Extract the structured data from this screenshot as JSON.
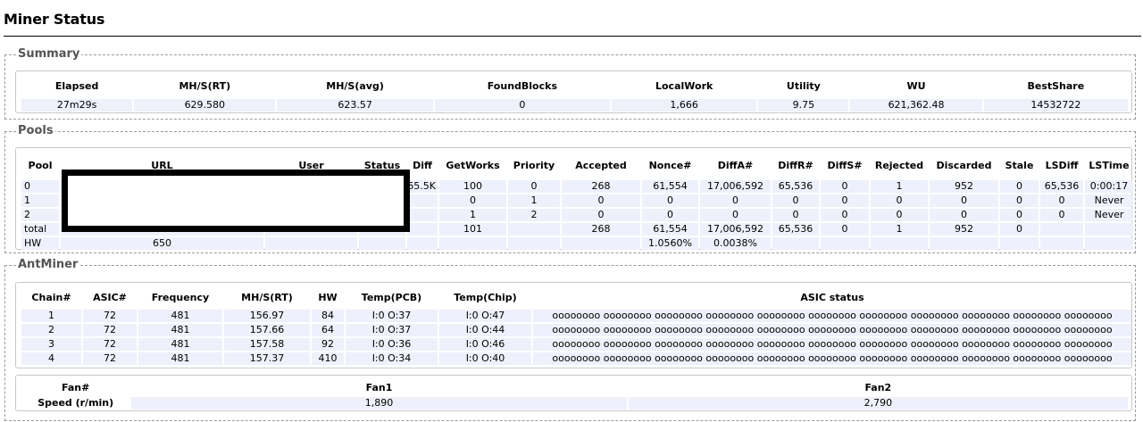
{
  "page_title": "Miner Status",
  "summary": {
    "legend": "Summary",
    "headers": [
      "Elapsed",
      "MH/S(RT)",
      "MH/S(avg)",
      "FoundBlocks",
      "LocalWork",
      "Utility",
      "WU",
      "BestShare"
    ],
    "row": [
      "27m29s",
      "629.580",
      "623.57",
      "0",
      "1,666",
      "9.75",
      "621,362.48",
      "14532722"
    ]
  },
  "pools": {
    "legend": "Pools",
    "headers": [
      "Pool",
      "URL",
      "User",
      "Status",
      "Diff",
      "GetWorks",
      "Priority",
      "Accepted",
      "Nonce#",
      "DiffA#",
      "DiffR#",
      "DiffS#",
      "Rejected",
      "Discarded",
      "Stale",
      "LSDiff",
      "LSTime"
    ],
    "rows": [
      [
        "0",
        "",
        "",
        "",
        "65.5K",
        "100",
        "0",
        "268",
        "61,554",
        "17,006,592",
        "65,536",
        "0",
        "1",
        "952",
        "0",
        "65,536",
        "0:00:17"
      ],
      [
        "1",
        "",
        "",
        "",
        "",
        "0",
        "1",
        "0",
        "0",
        "0",
        "0",
        "0",
        "0",
        "0",
        "0",
        "0",
        "Never"
      ],
      [
        "2",
        "",
        "",
        "",
        "",
        "1",
        "2",
        "0",
        "0",
        "0",
        "0",
        "0",
        "0",
        "0",
        "0",
        "0",
        "Never"
      ],
      [
        "total",
        "",
        "",
        "",
        "",
        "101",
        "",
        "268",
        "61,554",
        "17,006,592",
        "65,536",
        "0",
        "1",
        "952",
        "0",
        "",
        ""
      ],
      [
        "HW",
        "650",
        "",
        "",
        "",
        "",
        "",
        "",
        "1.0560%",
        "0.0038%",
        "",
        "",
        "",
        "",
        "",
        "",
        ""
      ]
    ]
  },
  "antminer": {
    "legend": "AntMiner",
    "headers": [
      "Chain#",
      "ASIC#",
      "Frequency",
      "MH/S(RT)",
      "HW",
      "Temp(PCB)",
      "Temp(Chip)",
      "ASIC status"
    ],
    "rows": [
      [
        "1",
        "72",
        "481",
        "156.97",
        "84",
        "I:0 O:37",
        "I:0 O:47",
        "oooooooo oooooooo oooooooo oooooooo oooooooo oooooooo oooooooo oooooooo oooooooo oooooooo oooooooo"
      ],
      [
        "2",
        "72",
        "481",
        "157.66",
        "64",
        "I:0 O:37",
        "I:0 O:44",
        "oooooooo oooooooo oooooooo oooooooo oooooooo oooooooo oooooooo oooooooo oooooooo oooooooo oooooooo"
      ],
      [
        "3",
        "72",
        "481",
        "157.58",
        "92",
        "I:0 O:36",
        "I:0 O:46",
        "oooooooo oooooooo oooooooo oooooooo oooooooo oooooooo oooooooo oooooooo oooooooo oooooooo oooooooo"
      ],
      [
        "4",
        "72",
        "481",
        "157.37",
        "410",
        "I:0 O:34",
        "I:0 O:40",
        "oooooooo oooooooo oooooooo oooooooo oooooooo oooooooo oooooooo oooooooo oooooooo oooooooo oooooooo"
      ]
    ],
    "fan_headers": [
      "Fan#",
      "Fan1",
      "Fan2"
    ],
    "fan_row": [
      "Speed (r/min)",
      "1,890",
      "2,790"
    ]
  }
}
